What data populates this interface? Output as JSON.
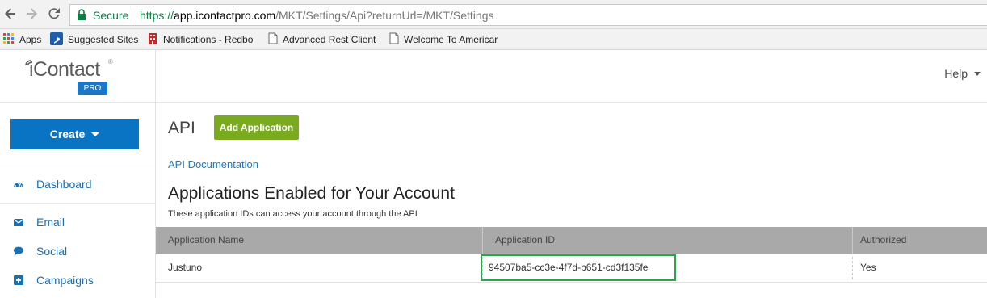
{
  "browser": {
    "secure_label": "Secure",
    "url_scheme": "https://",
    "url_host": "app.icontactpro.com",
    "url_path": "/MKT/Settings/Api?returnUrl=/MKT/Settings",
    "bookmarks": [
      {
        "label": "Apps",
        "icon": "apps-grid-icon"
      },
      {
        "label": "Suggested Sites",
        "icon": "bing-icon"
      },
      {
        "label": "Notifications - Redbo",
        "icon": "building-icon"
      },
      {
        "label": "Advanced Rest Client",
        "icon": "page-icon"
      },
      {
        "label": "Welcome To Americar",
        "icon": "page-icon"
      }
    ]
  },
  "app": {
    "logo_text": "iContact",
    "logo_reg": "®",
    "logo_badge": "PRO",
    "create_label": "Create",
    "help_label": "Help",
    "nav": [
      {
        "label": "Dashboard",
        "icon": "dashboard-icon"
      },
      {
        "label": "Email",
        "icon": "envelope-icon"
      },
      {
        "label": "Social",
        "icon": "chat-icon"
      },
      {
        "label": "Campaigns",
        "icon": "plus-square-icon"
      }
    ]
  },
  "main": {
    "title": "API",
    "add_application_label": "Add Application",
    "api_doc_link": "API Documentation",
    "section_title": "Applications Enabled for Your Account",
    "section_desc": "These application IDs can access your account through the API",
    "table": {
      "columns": [
        "Application Name",
        "Application ID",
        "Authorized"
      ],
      "rows": [
        {
          "name": "Justuno",
          "id": "94507ba5-cc3e-4f7d-b651-cd3f135fe",
          "authorized": "Yes"
        }
      ]
    }
  },
  "colors": {
    "primary_blue": "#0a74c4",
    "add_button_green": "#7aab1e",
    "highlight_green": "#2aa54a",
    "table_header": "#a9a9a9"
  }
}
